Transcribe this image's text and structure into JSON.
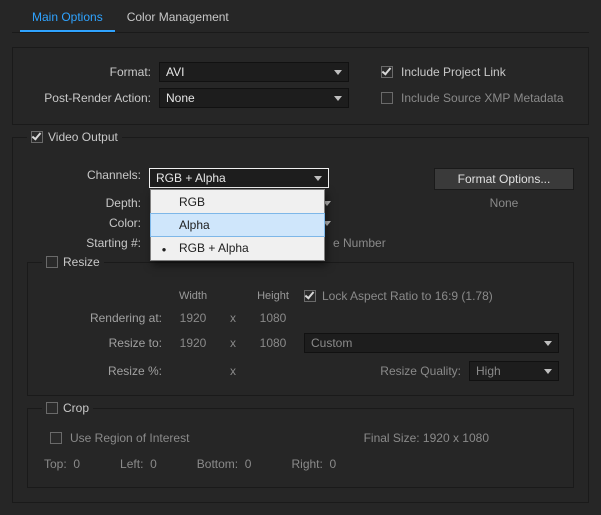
{
  "tabs": {
    "main": "Main Options",
    "color": "Color Management"
  },
  "format": {
    "label": "Format:",
    "value": "AVI",
    "include_link_label": "Include Project Link",
    "include_link_checked": true,
    "post_label": "Post-Render Action:",
    "post_value": "None",
    "include_xmp_label": "Include Source XMP Metadata",
    "include_xmp_checked": false
  },
  "video": {
    "legend": "Video Output",
    "checked": true,
    "channels_label": "Channels:",
    "channels_value": "RGB + Alpha",
    "channels_options": [
      "RGB",
      "Alpha",
      "RGB + Alpha"
    ],
    "depth_label": "Depth:",
    "color_label": "Color:",
    "starting_label": "Starting #:",
    "starting_tail": "e Number",
    "format_options_btn": "Format Options...",
    "none_text": "None"
  },
  "resize": {
    "legend": "Resize",
    "checked": false,
    "width": "Width",
    "height": "Height",
    "lock_label": "Lock Aspect Ratio to 16:9 (1.78)",
    "lock_checked": true,
    "rendering_label": "Rendering at:",
    "r_w": "1920",
    "r_h": "1080",
    "resize_to_label": "Resize to:",
    "t_w": "1920",
    "t_h": "1080",
    "preset": "Custom",
    "resize_pct_label": "Resize %:",
    "quality_label": "Resize Quality:",
    "quality_value": "High",
    "x": "x"
  },
  "crop": {
    "legend": "Crop",
    "checked": false,
    "roi_label": "Use Region of Interest",
    "final_label": "Final Size: 1920 x 1080",
    "top": "Top:",
    "left": "Left:",
    "bottom": "Bottom:",
    "right": "Right:",
    "zero": "0"
  }
}
